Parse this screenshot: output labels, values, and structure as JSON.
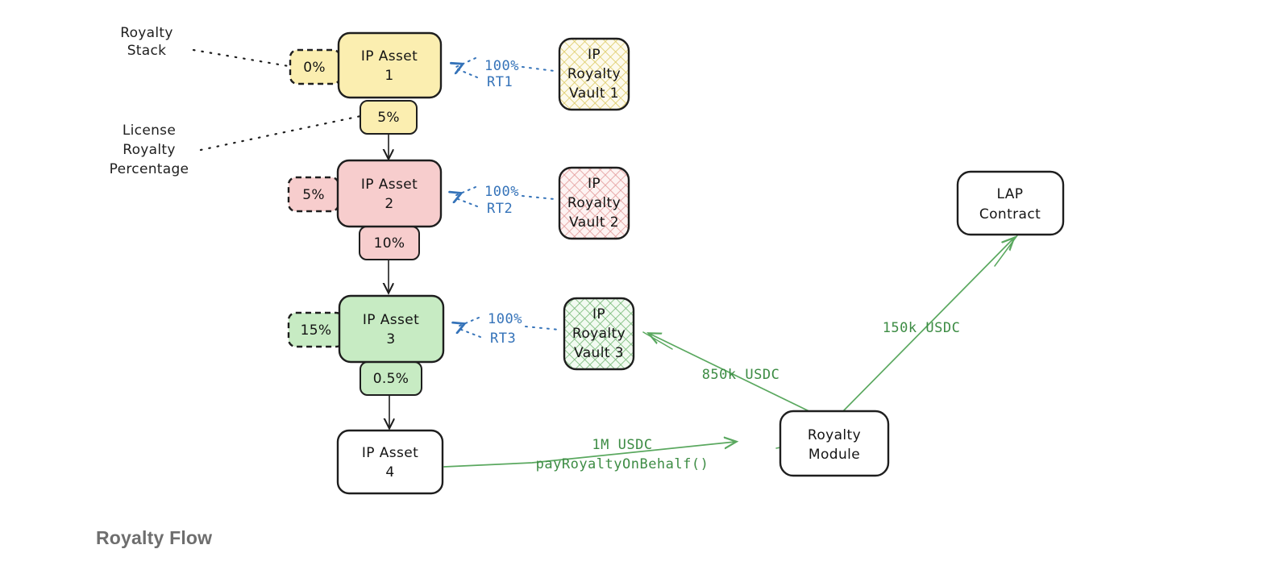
{
  "diagram": {
    "title": "Royalty Flow",
    "annotations": [
      {
        "id": "royalty-stack",
        "line1": "Royalty",
        "line2": "Stack",
        "line3": ""
      },
      {
        "id": "license-royalty-percentage",
        "line1": "License",
        "line2": "Royalty",
        "line3": "Percentage"
      }
    ],
    "assets": [
      {
        "id": "ip-asset-1",
        "line1": "IP Asset",
        "line2": "1",
        "stack": "0%",
        "license": "5%",
        "fill": "#fbeeb0",
        "stroke": "#1e1e1e"
      },
      {
        "id": "ip-asset-2",
        "line1": "IP Asset",
        "line2": "2",
        "stack": "5%",
        "license": "10%",
        "fill": "#f7cdcd",
        "stroke": "#1e1e1e"
      },
      {
        "id": "ip-asset-3",
        "line1": "IP Asset",
        "line2": "3",
        "stack": "15%",
        "license": "0.5%",
        "fill": "#c7ebc3",
        "stroke": "#1e1e1e"
      },
      {
        "id": "ip-asset-4",
        "line1": "IP Asset",
        "line2": "4",
        "stack": "",
        "license": "",
        "fill": "#ffffff",
        "stroke": "#1e1e1e"
      }
    ],
    "vaults": [
      {
        "id": "ip-royalty-vault-1",
        "line1": "IP",
        "line2": "Royalty",
        "line3": "Vault 1",
        "rt_pct": "100%",
        "rt_name": "RT1",
        "pattern": "#ddca63"
      },
      {
        "id": "ip-royalty-vault-2",
        "line1": "IP",
        "line2": "Royalty",
        "line3": "Vault 2",
        "rt_pct": "100%",
        "rt_name": "RT2",
        "pattern": "#e39a9a"
      },
      {
        "id": "ip-royalty-vault-3",
        "line1": "IP",
        "line2": "Royalty",
        "line3": "Vault 3",
        "rt_pct": "100%",
        "rt_name": "RT3",
        "pattern": "#73b874"
      }
    ],
    "contracts": [
      {
        "id": "lap-contract",
        "line1": "LAP",
        "line2": "Contract"
      },
      {
        "id": "royalty-module",
        "line1": "Royalty",
        "line2": "Module"
      }
    ],
    "flows": [
      {
        "id": "flow-pay-royalty",
        "line1": "1M USDC",
        "line2": "payRoyaltyOnBehalf()"
      },
      {
        "id": "flow-vault3-payout",
        "line1": "850k USDC",
        "line2": ""
      },
      {
        "id": "flow-lap-payout",
        "line1": "150k USDC",
        "line2": ""
      }
    ],
    "colors": {
      "blue": "#3573b9",
      "green_arrow": "#5aa85f",
      "green_text": "#3d8c44",
      "stroke": "#1e1e1e",
      "title": "#6e6e6e"
    }
  }
}
